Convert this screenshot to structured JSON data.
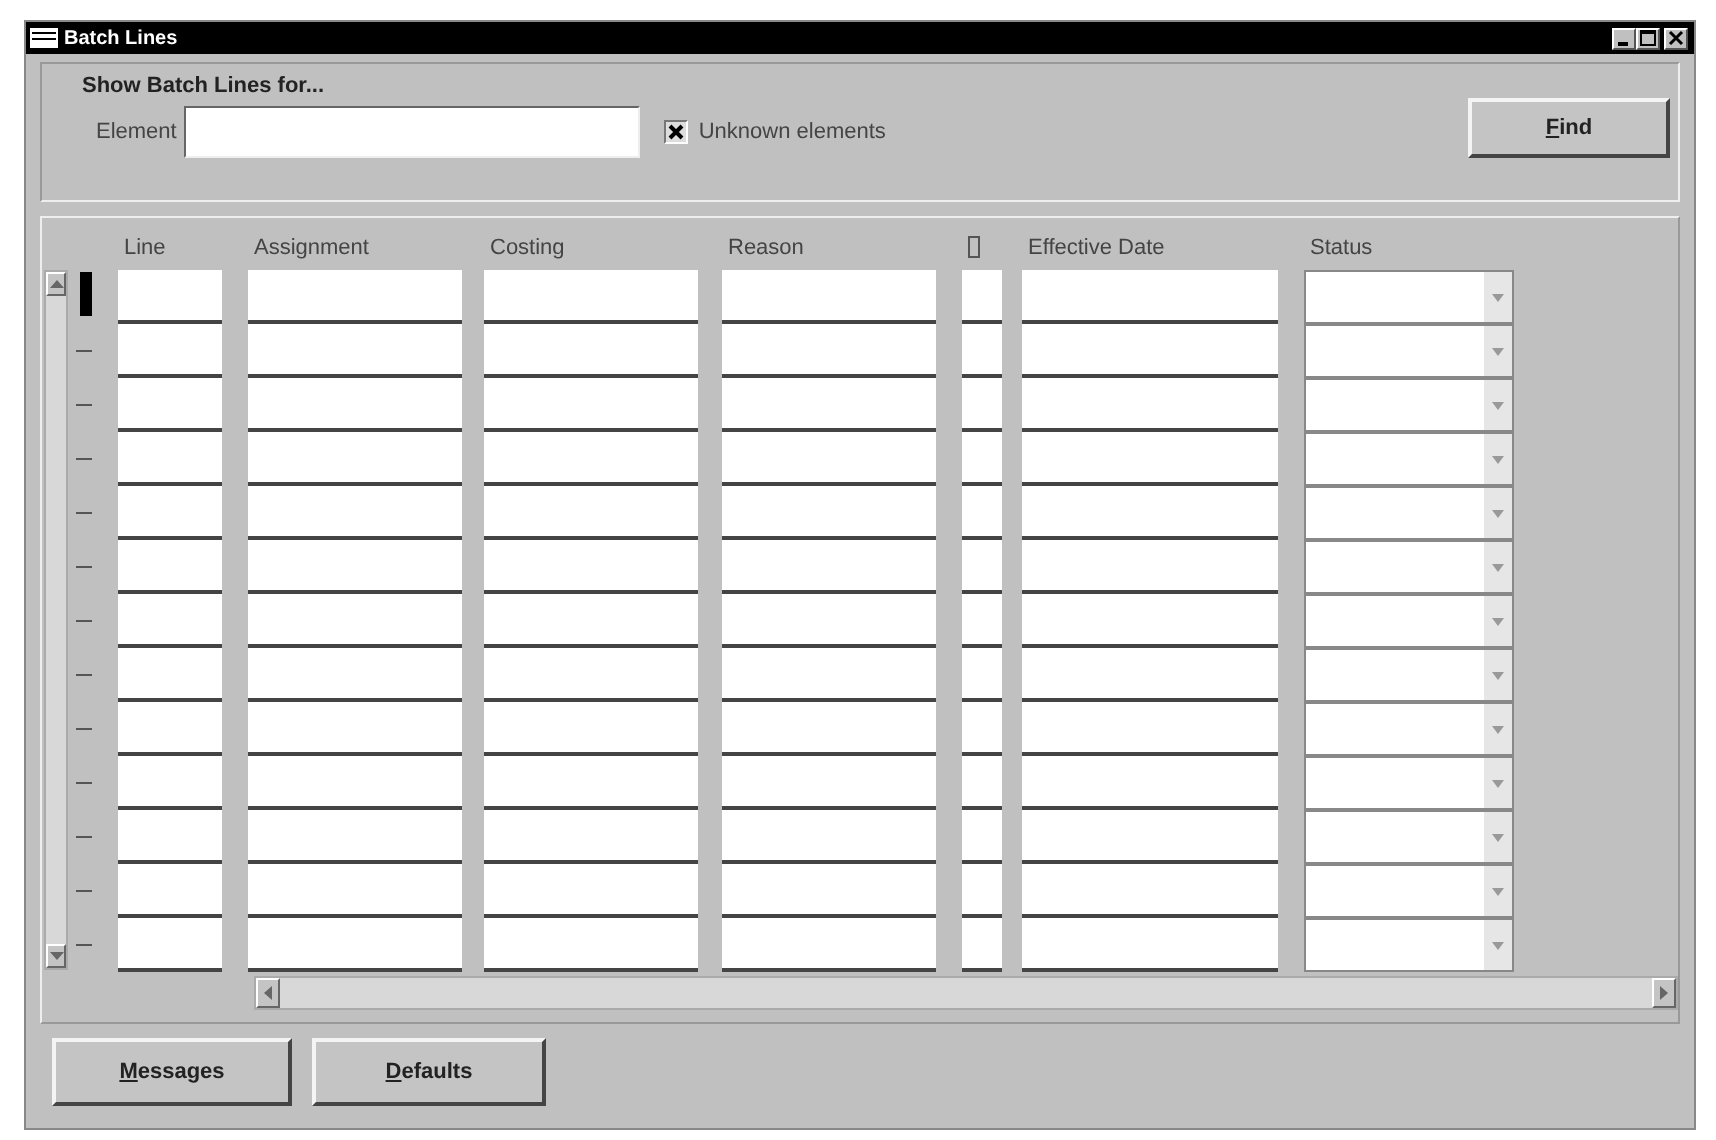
{
  "window": {
    "title": "Batch Lines"
  },
  "criteria": {
    "heading": "Show Batch Lines for...",
    "element": {
      "label": "Element"
    },
    "unknown_elements": {
      "label": "Unknown elements",
      "checked": true
    },
    "find_button": "Find"
  },
  "table": {
    "columns": [
      {
        "label": "Line",
        "kind": "text"
      },
      {
        "label": "Assignment",
        "kind": "text"
      },
      {
        "label": "Costing",
        "kind": "text"
      },
      {
        "label": "Reason",
        "kind": "text"
      },
      {
        "kind": "flag"
      },
      {
        "label": "Effective Date",
        "kind": "text"
      },
      {
        "label": "Status",
        "kind": "list"
      }
    ],
    "rows": [
      {
        "selected": true
      },
      {
        "selected": false
      },
      {
        "selected": false
      },
      {
        "selected": false
      },
      {
        "selected": false
      },
      {
        "selected": false
      },
      {
        "selected": false
      },
      {
        "selected": false
      },
      {
        "selected": false
      },
      {
        "selected": false
      },
      {
        "selected": false
      },
      {
        "selected": false
      },
      {
        "selected": false
      }
    ]
  },
  "buttons": [
    "Messages",
    "Defaults"
  ]
}
